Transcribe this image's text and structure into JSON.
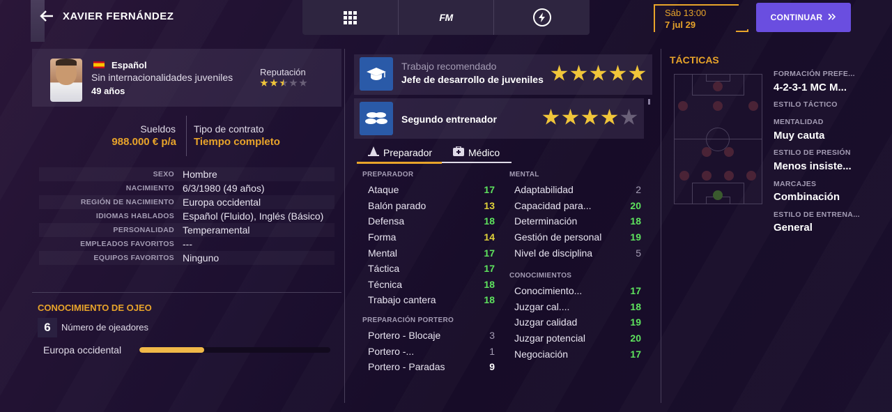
{
  "header": {
    "player_name": "XAVIER FERNÁNDEZ",
    "nav_icons": [
      "grid-icon",
      "fm-logo",
      "bolt-icon"
    ],
    "fm_label": "FM",
    "date_time": "Sáb 13:00",
    "date_day": "7 jul 29",
    "continue_label": "CONTINUAR"
  },
  "profile": {
    "nationality": "Español",
    "internationals": "Sin internacionalidades juveniles",
    "age": "49 años",
    "reputation_label": "Reputación",
    "reputation_stars": 2.5,
    "reputation_max": 5,
    "salary_label": "Sueldos",
    "salary_value": "988.000 € p/a",
    "contract_label": "Tipo de contrato",
    "contract_value": "Tiempo completo"
  },
  "info": [
    {
      "k": "SEXO",
      "v": "Hombre"
    },
    {
      "k": "NACIMIENTO",
      "v": "6/3/1980 (49 años)"
    },
    {
      "k": "REGIÓN DE NACIMIENTO",
      "v": "Europa occidental"
    },
    {
      "k": "IDIOMAS HABLADOS",
      "v": "Español (Fluido), Inglés (Básico)"
    },
    {
      "k": "PERSONALIDAD",
      "v": "Temperamental"
    },
    {
      "k": "EMPLEADOS FAVORITOS",
      "v": "---"
    },
    {
      "k": "EQUIPOS FAVORITOS",
      "v": "Ninguno"
    }
  ],
  "scouting": {
    "title": "CONOCIMIENTO DE OJEO",
    "scouts_count": "6",
    "scouts_label": "Número de ojeadores",
    "region": "Europa occidental",
    "knowledge_fraction": 0.34
  },
  "roles": [
    {
      "subtitle": "Trabajo recomendado",
      "name": "Jefe de desarrollo de juveniles",
      "stars": 5
    },
    {
      "subtitle": "",
      "name": "Segundo entrenador",
      "stars": 4
    }
  ],
  "tabs": [
    {
      "label": "Preparador",
      "active": true
    },
    {
      "label": "Médico",
      "active": false
    }
  ],
  "attributes": {
    "preparador_title": "PREPARADOR",
    "preparador": [
      {
        "name": "Ataque",
        "value": "17",
        "c": "g"
      },
      {
        "name": "Balón parado",
        "value": "13",
        "c": "y"
      },
      {
        "name": "Defensa",
        "value": "18",
        "c": "g"
      },
      {
        "name": "Forma",
        "value": "14",
        "c": "y"
      },
      {
        "name": "Mental",
        "value": "17",
        "c": "g"
      },
      {
        "name": "Táctica",
        "value": "17",
        "c": "g"
      },
      {
        "name": "Técnica",
        "value": "18",
        "c": "g"
      },
      {
        "name": "Trabajo cantera",
        "value": "18",
        "c": "g"
      }
    ],
    "portero_title": "PREPARACIÓN PORTERO",
    "portero": [
      {
        "name": "Portero - Blocaje",
        "value": "3",
        "c": "d"
      },
      {
        "name": "Portero -...",
        "value": "1",
        "c": "d"
      },
      {
        "name": "Portero - Paradas",
        "value": "9",
        "c": "w"
      }
    ],
    "mental_title": "MENTAL",
    "mental": [
      {
        "name": "Adaptabilidad",
        "value": "2",
        "c": "d"
      },
      {
        "name": "Capacidad para...",
        "value": "20",
        "c": "g"
      },
      {
        "name": "Determinación",
        "value": "18",
        "c": "g"
      },
      {
        "name": "Gestión de personal",
        "value": "19",
        "c": "g"
      },
      {
        "name": "Nivel de disciplina",
        "value": "5",
        "c": "d"
      }
    ],
    "conocimientos_title": "CONOCIMIENTOS",
    "conocimientos": [
      {
        "name": "Conocimiento...",
        "value": "17",
        "c": "g"
      },
      {
        "name": "Juzgar cal....",
        "value": "18",
        "c": "g"
      },
      {
        "name": "Juzgar calidad",
        "value": "19",
        "c": "g"
      },
      {
        "name": "Juzgar potencial",
        "value": "20",
        "c": "g"
      },
      {
        "name": "Negociación",
        "value": "17",
        "c": "g"
      }
    ]
  },
  "tactics": {
    "title": "TÁCTICAS",
    "items": [
      {
        "k": "FORMACIÓN PREFE...",
        "v": "4-2-3-1 MC M..."
      },
      {
        "k": "ESTILO TÁCTICO",
        "v": ""
      },
      {
        "k": "MENTALIDAD",
        "v": "Muy cauta"
      },
      {
        "k": "ESTILO DE PRESIÓN",
        "v": "Menos insiste..."
      },
      {
        "k": "MARCAJES",
        "v": "Combinación"
      },
      {
        "k": "ESTILO DE ENTRENA...",
        "v": "General"
      }
    ]
  },
  "colors": {
    "accent": "#e8a42a",
    "button": "#6a4ee0",
    "good": "#5ee35e",
    "medium": "#e0d23a"
  }
}
